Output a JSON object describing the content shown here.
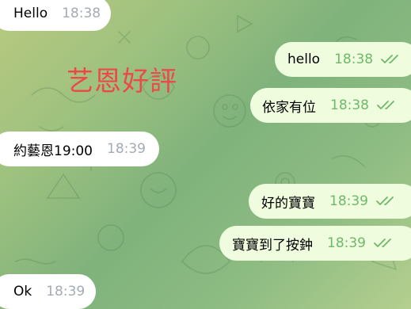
{
  "watermark_text": "艺恩好評",
  "messages": [
    {
      "text": "Hello",
      "time": "18:38",
      "direction": "incoming"
    },
    {
      "text": "hello",
      "time": "18:38",
      "direction": "outgoing",
      "status": "read"
    },
    {
      "text": "依家有位",
      "time": "18:38",
      "direction": "outgoing",
      "status": "read"
    },
    {
      "text": "約藝恩19:00",
      "time": "18:39",
      "direction": "incoming"
    },
    {
      "text": "好的寶寶",
      "time": "18:39",
      "direction": "outgoing",
      "status": "read"
    },
    {
      "text": "寶寶到了按鈡",
      "time": "18:39",
      "direction": "outgoing",
      "status": "read"
    },
    {
      "text": "Ok",
      "time": "18:39",
      "direction": "incoming"
    }
  ],
  "colors": {
    "incoming_bubble": "#ffffff",
    "outgoing_bubble": "#effdde",
    "outgoing_time": "#6fb86a",
    "incoming_time": "#a3abb3",
    "watermark": "#ec4a4a"
  },
  "icons": {
    "read_receipt": "double-check-icon"
  }
}
